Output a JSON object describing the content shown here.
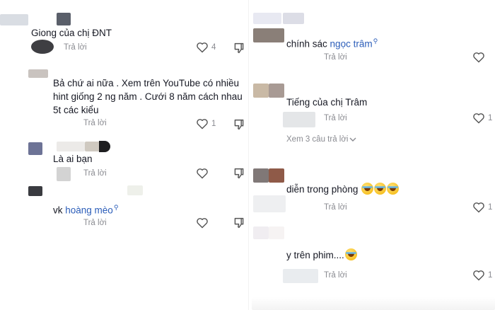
{
  "left": {
    "comments": [
      {
        "text": "Giong của chị ĐNT",
        "reply_label": "Trả lời",
        "like_count": "4"
      },
      {
        "text": "Bả chứ ai nữa . Xem trên YouTube có nhiều hint giống 2 ng năm . Cưới 8 năm cách nhau 5t các kiểu",
        "reply_label": "Trả lời",
        "like_count": "1"
      },
      {
        "text": "Là ai bạn",
        "reply_label": "Trả lời",
        "like_count": ""
      },
      {
        "text_prefix": "vk ",
        "mention": "hoàng mèo",
        "reply_label": "Trả lời",
        "like_count": ""
      }
    ]
  },
  "right": {
    "comments": [
      {
        "text_prefix": "chính sác ",
        "mention": "ngọc trâm",
        "reply_label": "Trả lời",
        "like_count": ""
      },
      {
        "text": "Tiếng của chị Trâm",
        "reply_label": "Trả lời",
        "like_count": "1",
        "view_replies": "Xem 3 câu trả lời"
      },
      {
        "text": "diễn trong phòng",
        "emoji_count": 3,
        "reply_label": "Trả lời",
        "like_count": "1"
      },
      {
        "text": "y trên phim....",
        "emoji_count": 1,
        "reply_label": "Trả lời",
        "like_count": "1"
      }
    ]
  },
  "icons": {
    "like": "heart-outline-icon",
    "dislike": "thumbs-down-icon",
    "mention": "search-small-icon",
    "emoji": "laughing-tears-emoji",
    "expand": "chevron-down-icon"
  },
  "colors": {
    "text": "#161823",
    "secondary": "#8a8b91",
    "mention": "#2b5db9"
  }
}
